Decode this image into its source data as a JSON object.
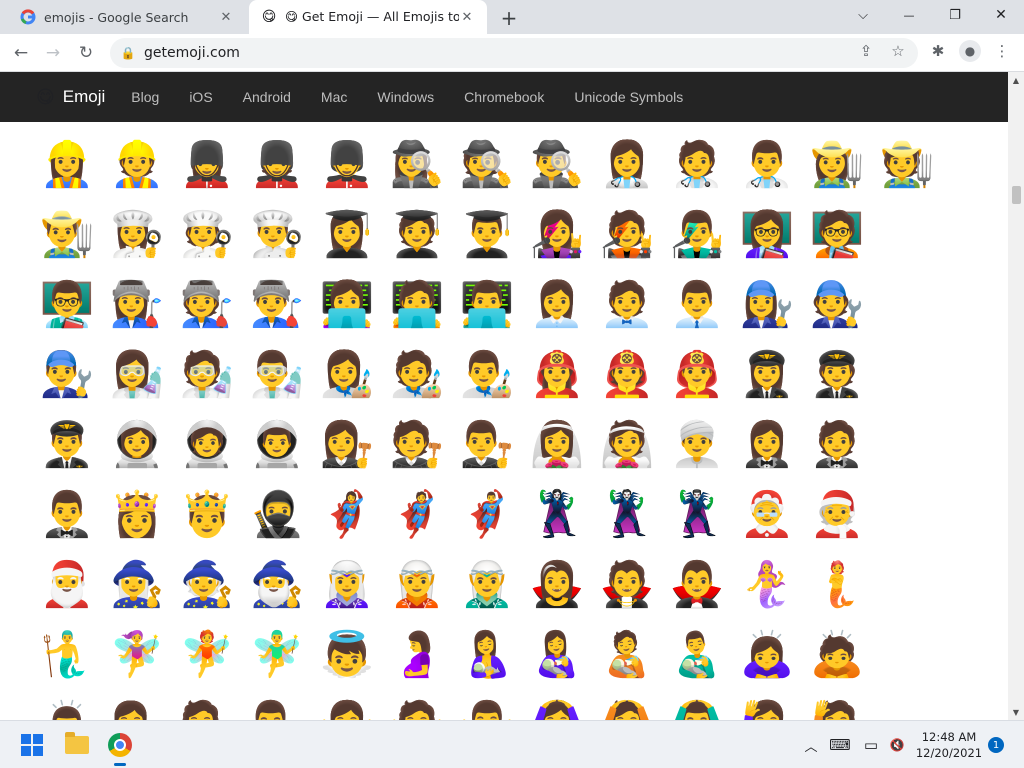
{
  "browser": {
    "tabs": [
      {
        "title": "emojis - Google Search",
        "favicon": "google-g-icon"
      },
      {
        "title": "😋 Get Emoji — All Emojis to ✂️",
        "favicon": "emoji-face-icon"
      }
    ],
    "window_controls": {
      "list": "⌵",
      "minimize": "—",
      "maximize": "❐",
      "close": "✕"
    },
    "new_tab": "+",
    "nav": {
      "back": "←",
      "forward": "→",
      "reload": "↻"
    },
    "address": {
      "url": "getemoji.com",
      "lock": "🔒"
    },
    "toolbar_icons": {
      "share": "⇪",
      "bookmark": "☆",
      "extensions": "✱",
      "profile": "●",
      "menu": "⋮"
    }
  },
  "site": {
    "brand_icon": "😋",
    "brand": "Emoji",
    "nav": [
      "Blog",
      "iOS",
      "Android",
      "Mac",
      "Windows",
      "Chromebook",
      "Unicode Symbols"
    ]
  },
  "emoji_rows": [
    [
      "👷‍♀️",
      "👷",
      "💂‍♀️",
      "💂",
      "💂‍♂️",
      "🕵️‍♀️",
      "🕵️",
      "🕵️‍♂️",
      "👩‍⚕️",
      "🧑‍⚕️",
      "👨‍⚕️",
      "👩‍🌾",
      "🧑‍🌾"
    ],
    [
      "👨‍🌾",
      "👩‍🍳",
      "🧑‍🍳",
      "👨‍🍳",
      "👩‍🎓",
      "🧑‍🎓",
      "👨‍🎓",
      "👩‍🎤",
      "🧑‍🎤",
      "👨‍🎤",
      "👩‍🏫",
      "🧑‍🏫"
    ],
    [
      "👨‍🏫",
      "👩‍🏭",
      "🧑‍🏭",
      "👨‍🏭",
      "👩‍💻",
      "🧑‍💻",
      "👨‍💻",
      "👩‍💼",
      "🧑‍💼",
      "👨‍💼",
      "👩‍🔧",
      "🧑‍🔧"
    ],
    [
      "👨‍🔧",
      "👩‍🔬",
      "🧑‍🔬",
      "👨‍🔬",
      "👩‍🎨",
      "🧑‍🎨",
      "👨‍🎨",
      "👩‍🚒",
      "🧑‍🚒",
      "👨‍🚒",
      "👩‍✈️",
      "🧑‍✈️"
    ],
    [
      "👨‍✈️",
      "👩‍🚀",
      "🧑‍🚀",
      "👨‍🚀",
      "👩‍⚖️",
      "🧑‍⚖️",
      "👨‍⚖️",
      "👰‍♀️",
      "👰",
      "👳‍♂️",
      "🤵‍♀️",
      "🤵"
    ],
    [
      "🤵‍♂️",
      "👸",
      "🤴",
      "🥷",
      "🦸‍♀️",
      "🦸",
      "🦸‍♂️",
      "🦹‍♀️",
      "🦹",
      "🦹‍♂️",
      "🤶",
      "🧑‍🎄"
    ],
    [
      "🎅",
      "🧙‍♀️",
      "🧙",
      "🧙‍♂️",
      "🧝‍♀️",
      "🧝",
      "🧝‍♂️",
      "🧛‍♀️",
      "🧛",
      "🧛‍♂️",
      "🧜‍♀️",
      "🧜"
    ],
    [
      "🧜‍♂️",
      "🧚‍♀️",
      "🧚",
      "🧚‍♂️",
      "👼",
      "🤰",
      "🤱",
      "👩‍🍼",
      "🧑‍🍼",
      "👨‍🍼",
      "🙇‍♀️",
      "🙇"
    ],
    [
      "🙇‍♂️",
      "💁‍♀️",
      "💁",
      "💁‍♂️",
      "🙅‍♀️",
      "🙅",
      "🙅‍♂️",
      "🙆‍♀️",
      "🙆",
      "🙆‍♂️",
      "🙋‍♀️",
      "🙋"
    ]
  ],
  "taskbar": {
    "tray": {
      "chevron": "︿",
      "keyboard": "⌨",
      "display": "▭",
      "volume": "🔇"
    },
    "time": "12:48 AM",
    "date": "12/20/2021",
    "notifications": "1"
  }
}
